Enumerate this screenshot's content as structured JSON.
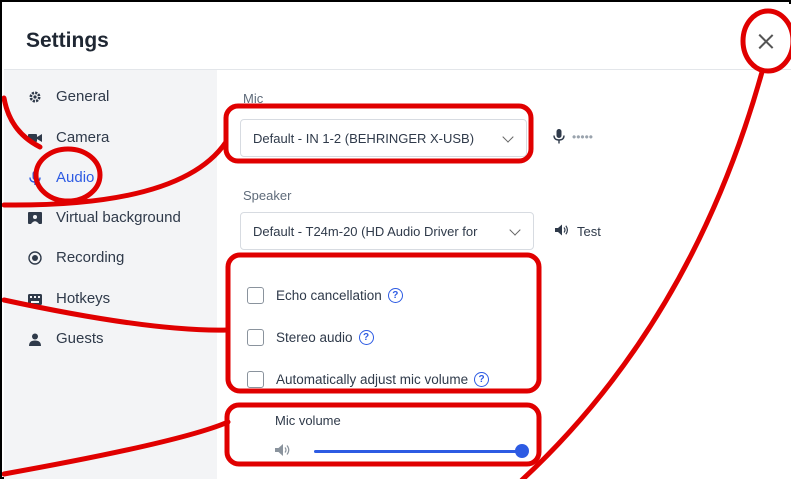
{
  "window": {
    "title": "Settings",
    "close_icon": "close-icon"
  },
  "sidebar": {
    "items": [
      {
        "label": "General",
        "icon": "gear-icon",
        "active": false
      },
      {
        "label": "Camera",
        "icon": "camera-icon",
        "active": false
      },
      {
        "label": "Audio",
        "icon": "microphone-icon",
        "active": true
      },
      {
        "label": "Virtual background",
        "icon": "virtual-background-icon",
        "active": false
      },
      {
        "label": "Recording",
        "icon": "record-icon",
        "active": false
      },
      {
        "label": "Hotkeys",
        "icon": "keyboard-icon",
        "active": false
      },
      {
        "label": "Guests",
        "icon": "person-icon",
        "active": false
      }
    ]
  },
  "audio": {
    "mic_label": "Mic",
    "mic_value": "Default - IN 1-2 (BEHRINGER X-USB)",
    "mic_level_text": "•••••",
    "speaker_label": "Speaker",
    "speaker_value": "Default - T24m-20 (HD Audio Driver for",
    "test_label": "Test",
    "options": [
      {
        "label": "Echo cancellation",
        "checked": false
      },
      {
        "label": "Stereo audio",
        "checked": false
      },
      {
        "label": "Automatically adjust mic volume",
        "checked": false
      }
    ],
    "mic_volume_label": "Mic volume",
    "mic_volume_value": 1.0
  },
  "colors": {
    "accent": "#2d5be3",
    "annotation": "#e00000",
    "sidebar_bg": "#f3f4f6"
  }
}
